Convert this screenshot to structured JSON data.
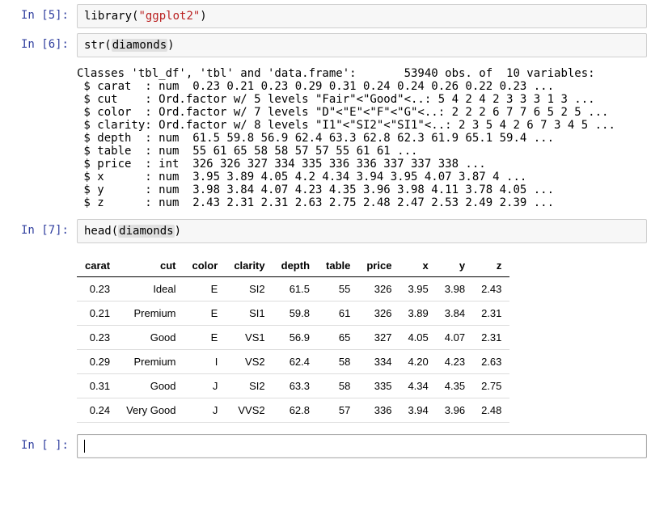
{
  "cells": {
    "cell5": {
      "prompt": "In  [5]:",
      "code_prefix": "library(",
      "code_string": "\"ggplot2\"",
      "code_suffix": ")"
    },
    "cell6": {
      "prompt": "In  [6]:",
      "code_prefix": "str(",
      "code_var": "diamonds",
      "code_suffix": ")",
      "output": "Classes 'tbl_df', 'tbl' and 'data.frame':       53940 obs. of  10 variables:\n $ carat  : num  0.23 0.21 0.23 0.29 0.31 0.24 0.24 0.26 0.22 0.23 ...\n $ cut    : Ord.factor w/ 5 levels \"Fair\"<\"Good\"<..: 5 4 2 4 2 3 3 3 1 3 ...\n $ color  : Ord.factor w/ 7 levels \"D\"<\"E\"<\"F\"<\"G\"<..: 2 2 2 6 7 7 6 5 2 5 ...\n $ clarity: Ord.factor w/ 8 levels \"I1\"<\"SI2\"<\"SI1\"<..: 2 3 5 4 2 6 7 3 4 5 ...\n $ depth  : num  61.5 59.8 56.9 62.4 63.3 62.8 62.3 61.9 65.1 59.4 ...\n $ table  : num  55 61 65 58 58 57 57 55 61 61 ...\n $ price  : int  326 326 327 334 335 336 336 337 337 338 ...\n $ x      : num  3.95 3.89 4.05 4.2 4.34 3.94 3.95 4.07 3.87 4 ...\n $ y      : num  3.98 3.84 4.07 4.23 4.35 3.96 3.98 4.11 3.78 4.05 ...\n $ z      : num  2.43 2.31 2.31 2.63 2.75 2.48 2.47 2.53 2.49 2.39 ..."
    },
    "cell7": {
      "prompt": "In  [7]:",
      "code_prefix": "head(",
      "code_var": "diamonds",
      "code_suffix": ")",
      "table": {
        "headers": [
          "carat",
          "cut",
          "color",
          "clarity",
          "depth",
          "table",
          "price",
          "x",
          "y",
          "z"
        ],
        "rows": [
          [
            "0.23",
            "Ideal",
            "E",
            "SI2",
            "61.5",
            "55",
            "326",
            "3.95",
            "3.98",
            "2.43"
          ],
          [
            "0.21",
            "Premium",
            "E",
            "SI1",
            "59.8",
            "61",
            "326",
            "3.89",
            "3.84",
            "2.31"
          ],
          [
            "0.23",
            "Good",
            "E",
            "VS1",
            "56.9",
            "65",
            "327",
            "4.05",
            "4.07",
            "2.31"
          ],
          [
            "0.29",
            "Premium",
            "I",
            "VS2",
            "62.4",
            "58",
            "334",
            "4.20",
            "4.23",
            "2.63"
          ],
          [
            "0.31",
            "Good",
            "J",
            "SI2",
            "63.3",
            "58",
            "335",
            "4.34",
            "4.35",
            "2.75"
          ],
          [
            "0.24",
            "Very Good",
            "J",
            "VVS2",
            "62.8",
            "57",
            "336",
            "3.94",
            "3.96",
            "2.48"
          ]
        ]
      }
    },
    "cellEmpty": {
      "prompt": "In  [ ]:"
    }
  }
}
